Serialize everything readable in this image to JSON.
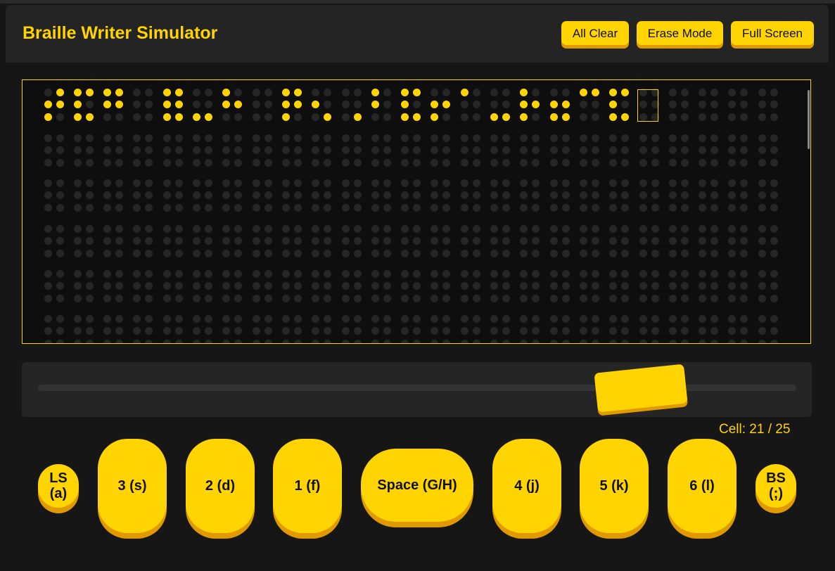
{
  "app": {
    "title": "Braille Writer Simulator"
  },
  "toolbar": {
    "buttons": [
      {
        "id": "all-clear",
        "label": "All Clear"
      },
      {
        "id": "erase-mode",
        "label": "Erase Mode"
      },
      {
        "id": "full-screen",
        "label": "Full Screen"
      }
    ]
  },
  "paper": {
    "columns": 25,
    "rows": 6,
    "cursor_cell": 21,
    "first_line_cells": [
      [
        2,
        4,
        1
      ],
      [
        4,
        1,
        5
      ],
      [
        4,
        5,
        0
      ],
      [
        0,
        0,
        0
      ],
      [
        5,
        5,
        4
      ],
      [
        0,
        0,
        3
      ],
      [
        1,
        4,
        0
      ],
      [
        0,
        0,
        0
      ],
      [
        4,
        5,
        1
      ],
      [
        0,
        1,
        2
      ],
      [
        0,
        0,
        2
      ],
      [
        1,
        1,
        0
      ],
      [
        5,
        1,
        6
      ],
      [
        0,
        5,
        1
      ],
      [
        1,
        0,
        0
      ],
      [
        0,
        0,
        6
      ],
      [
        1,
        4,
        1
      ],
      [
        0,
        4,
        4
      ],
      [
        3,
        0,
        0
      ],
      [
        4,
        1,
        4
      ],
      [
        0,
        0,
        0
      ],
      [
        0,
        0,
        0
      ],
      [
        0,
        0,
        0
      ],
      [
        0,
        0,
        0
      ],
      [
        0,
        0,
        0
      ]
    ]
  },
  "carriage": {
    "position_fraction": 0.84
  },
  "status": {
    "cell_label": "Cell: 21 / 25"
  },
  "keys": {
    "ls": "LS\n(a)",
    "dot3": "3 (s)",
    "dot2": "2 (d)",
    "dot1": "1 (f)",
    "space": "Space (G/H)",
    "dot4": "4 (j)",
    "dot5": "5 (k)",
    "dot6": "6 (l)",
    "bs": "BS\n(;)"
  },
  "colors": {
    "accent": "#ffd400",
    "accent_shadow": "#e09a00",
    "background": "#161616",
    "panel": "#242424",
    "dot_off": "#262626"
  }
}
